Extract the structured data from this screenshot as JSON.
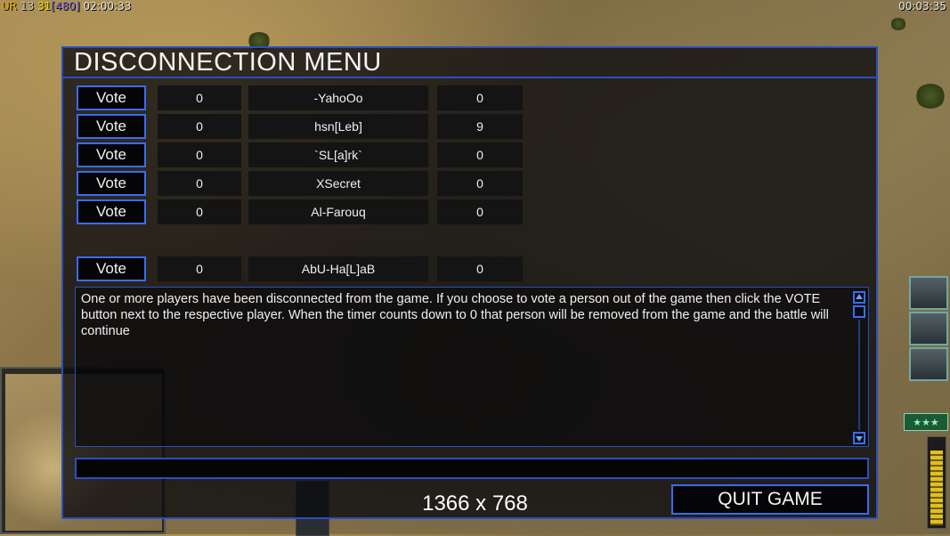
{
  "hud": {
    "ur_label": "UR",
    "num1": "13",
    "num2": "31",
    "num3": "[480]",
    "game_clock": "02:00:33",
    "right_clock": "00:03:35"
  },
  "rank_stars": "★★★",
  "dialog": {
    "title": "DISCONNECTION MENU",
    "players": [
      {
        "vote_label": "Vote",
        "votes": "0",
        "name": "-YahoOo",
        "timer": "0"
      },
      {
        "vote_label": "Vote",
        "votes": "0",
        "name": "hsn[Leb]",
        "timer": "9"
      },
      {
        "vote_label": "Vote",
        "votes": "0",
        "name": "`SL[a]rk`",
        "timer": "0"
      },
      {
        "vote_label": "Vote",
        "votes": "0",
        "name": "XSecret",
        "timer": "0"
      },
      {
        "vote_label": "Vote",
        "votes": "0",
        "name": "Al-Farouq",
        "timer": "0"
      },
      {
        "vote_label": "Vote",
        "votes": "0",
        "name": "AbU-Ha[L]aB",
        "timer": "0"
      }
    ],
    "message": "One or more players have been disconnected from the game. If you choose to vote a person out of the game then click the VOTE button next to the respective player. When the timer counts down to 0 that person will be removed from the game and the battle will continue",
    "chat_input_value": "",
    "resolution_text": "1366 x 768",
    "quit_label": "QUIT GAME"
  },
  "colors": {
    "border_blue": "#3a6cf0",
    "title_text": "#f4f4f4"
  }
}
